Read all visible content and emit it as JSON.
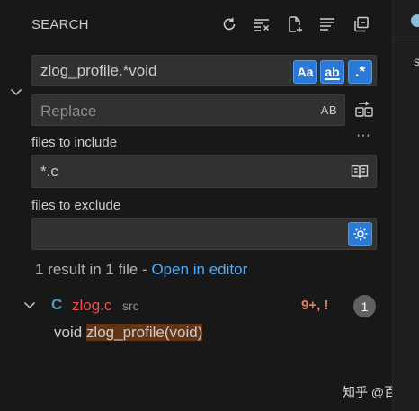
{
  "header": {
    "title": "SEARCH",
    "actions": [
      "refresh-icon",
      "clear-results-icon",
      "new-search-editor-icon",
      "view-as-tree-icon",
      "collapse-all-icon"
    ]
  },
  "search": {
    "value": "zlog_profile.*void",
    "options": {
      "match_case": "Aa",
      "whole_word": "ab",
      "regex": ".*"
    }
  },
  "replace": {
    "placeholder": "Replace",
    "preserve_case": "AB"
  },
  "include": {
    "label": "files to include",
    "value": "*.c"
  },
  "exclude": {
    "label": "files to exclude",
    "value": ""
  },
  "summary": {
    "text": "1 result in 1 file - ",
    "link": "Open in editor"
  },
  "results": [
    {
      "lang_badge": "C",
      "file": "zlog.c",
      "folder": "src",
      "problems": "9+, !",
      "count": "1",
      "matches": [
        {
          "prefix": "void ",
          "highlight": "zlog_profile(void)"
        }
      ]
    }
  ],
  "right_strip": {
    "tab_text": "s"
  },
  "watermark": "知乎 @百里",
  "colors": {
    "active_option": "#2b79d6",
    "link": "#4daafc",
    "error_file": "#f14c4c",
    "problems": "#e0825b",
    "match_highlight": "#623315"
  }
}
